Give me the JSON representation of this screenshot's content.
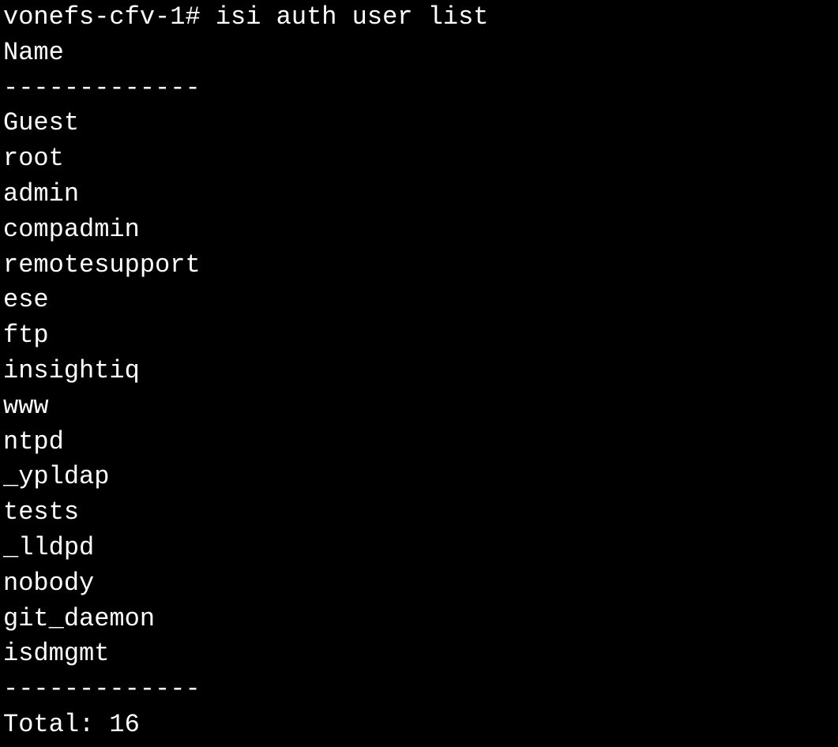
{
  "prompt": "vonefs-cfv-1#",
  "command": "isi auth user list",
  "header": "Name",
  "separator": "-------------",
  "users": [
    "Guest",
    "root",
    "admin",
    "compadmin",
    "remotesupport",
    "ese",
    "ftp",
    "insightiq",
    "www",
    "ntpd",
    "_ypldap",
    "tests",
    "_lldpd",
    "nobody",
    "git_daemon",
    "isdmgmt"
  ],
  "footer_separator": "-------------",
  "total_label": "Total:",
  "total_count": "16"
}
